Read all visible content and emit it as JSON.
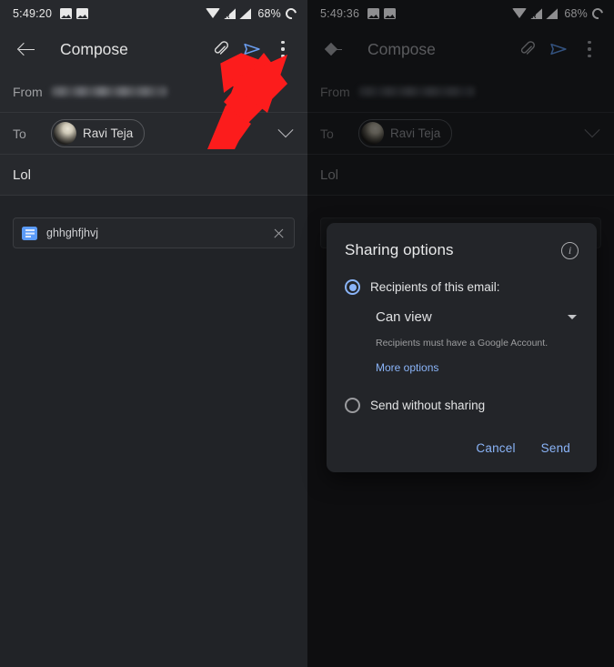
{
  "left_panel": {
    "status_bar": {
      "time": "5:49:20",
      "battery_percent": "68%",
      "icons": [
        "photos-icon",
        "image-icon",
        "wifi-icon",
        "signal-roaming-icon",
        "signal-icon",
        "battery-icon"
      ]
    },
    "app_bar": {
      "title": "Compose",
      "back_icon": "back-arrow-icon",
      "attach_icon": "paperclip-icon",
      "send_icon": "send-icon",
      "overflow_icon": "more-vert-icon"
    },
    "from": {
      "label": "From",
      "value_redacted": true
    },
    "to": {
      "label": "To",
      "recipient": "Ravi Teja",
      "expand_icon": "chevron-down-icon"
    },
    "subject": "Lol",
    "attachment": {
      "name": "ghhghfjhvj",
      "file_icon": "google-docs-icon",
      "remove_icon": "close-icon"
    },
    "annotation": {
      "type": "arrow",
      "color": "#fc1c1c",
      "points_to": "send-icon"
    }
  },
  "right_panel": {
    "status_bar": {
      "time": "5:49:36",
      "battery_percent": "68%"
    },
    "app_bar": {
      "title": "Compose"
    },
    "from": {
      "label": "From"
    },
    "to": {
      "label": "To",
      "recipient": "Ravi Teja"
    },
    "subject": "Lol",
    "dialog": {
      "title": "Sharing options",
      "info_icon": "info-icon",
      "options": [
        {
          "label": "Recipients of this email:",
          "selected": true,
          "permission_value": "Can view",
          "helper_text": "Recipients must have a Google Account.",
          "more_link": "More options"
        },
        {
          "label": "Send without sharing",
          "selected": false
        }
      ],
      "cancel_label": "Cancel",
      "send_label": "Send"
    }
  },
  "colors": {
    "accent_blue": "#8ab4f8",
    "surface": "#27292d",
    "dialog_surface": "#232529",
    "body_surface": "#212327",
    "annotation_red": "#fc1c1c"
  }
}
